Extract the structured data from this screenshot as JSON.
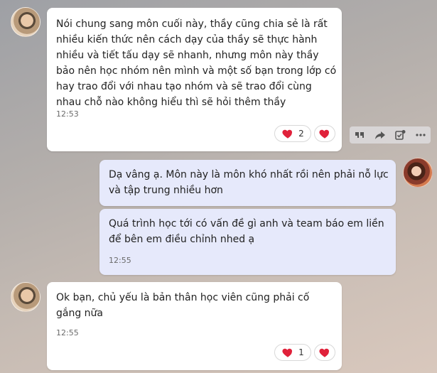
{
  "messages": [
    {
      "text": "Nói chung sang môn cuối này, thầy cũng chia sẻ là rất nhiều kiến thức nên cách dạy của thầy sẽ thực hành nhiều và tiết tấu dạy sẽ nhanh, nhưng môn này thầy bảo nên học nhóm nên mình và một số bạn trong lớp có hay trao đổi với nhau tạo nhóm và sẽ trao đổi cùng nhau chỗ nào không hiểu thì sẽ hỏi thêm thầy",
      "time": "12:53",
      "reaction_count": "2"
    },
    {
      "text": "Dạ vâng ạ. Môn này là môn khó nhất rồi nên phải nỗ lực và tập trung nhiều hơn"
    },
    {
      "text": "Quá trình học tới có vấn đề gì anh và team báo em liền để bên em điều chỉnh nhed ạ",
      "time": "12:55"
    },
    {
      "text": "Ok bạn, chủ yếu là bản thân học viên cũng phải cố gắng nữa",
      "time": "12:55",
      "reaction_count": "1"
    }
  ],
  "icons": {
    "heart": "heart-icon",
    "quote": "quote-icon",
    "forward": "forward-icon",
    "task": "task-icon",
    "more": "more-icon"
  },
  "colors": {
    "heart": "#e0213a",
    "incoming_bubble": "#ffffff",
    "outgoing_bubble": "#e6e9fb"
  }
}
